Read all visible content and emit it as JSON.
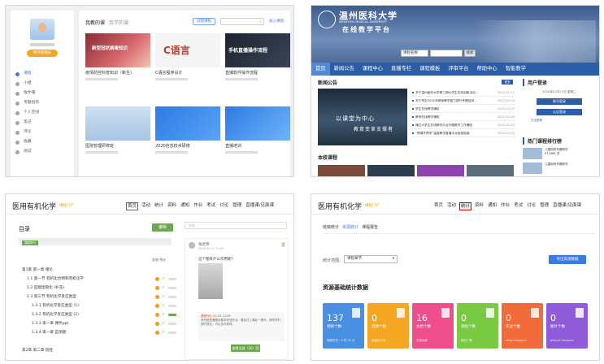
{
  "p1": {
    "badge": "教师管理员",
    "menu": [
      "课程",
      "小组",
      "收件箱",
      "专题创作",
      "个人空间",
      "笔记",
      "评论",
      "收藏",
      "测试"
    ],
    "tabs": [
      "我教的课",
      "我学的课"
    ],
    "create_btn": "创建课程",
    "join_label": "加入课程",
    "courses": [
      {
        "title": "疫情防控科普知识（新生）",
        "img": "新型冠状病毒知识"
      },
      {
        "title": "C语言程序设计",
        "img": "C语言"
      },
      {
        "title": "直播软件操作流程",
        "img": "手机直播操作流程"
      },
      {
        "title": "医院管理研修班",
        "img": ""
      },
      {
        "title": "2020信息技术研修",
        "img": ""
      },
      {
        "title": "直播培训",
        "img": ""
      }
    ]
  },
  "p2": {
    "uni_cn": "温州医科大学",
    "uni_en": "WENZHOU MEDICAL UNIVERSITY",
    "platform": "在线教学平台",
    "search_select": "课程名称",
    "search_btn": "搜索",
    "nav": [
      "首页",
      "新闻公告",
      "课程中心",
      "直播专栏",
      "课程模板",
      "评审平台",
      "帮助中心",
      "智能教学"
    ],
    "news_title": "新闻公告",
    "more": "更多",
    "photo_line1": "以课堂为中心",
    "photo_line2": "教育变革支撑者",
    "news": [
      {
        "t": "关于温州医科大学第三期大学生在线创新活动...",
        "d": "2020-02-11"
      },
      {
        "t": "关于举办2020年教师教学能力提升专题培训...",
        "d": "2020-02-09"
      },
      {
        "t": "学生在线教学通知",
        "d": "2020-02-07"
      },
      {
        "t": "教师在线教学通知",
        "d": "2020-02-06"
      },
      {
        "t": "通过大学生在线教学平台开展教学工作通知",
        "d": "2020-02-05"
      },
      {
        "t": "“停课不停学”温医教学直播平台使用指南",
        "d": "2020-02-03"
      }
    ],
    "login_title": "用户登录",
    "login_date": "2020年02月11日 星期二",
    "login_btn1": "账号登录",
    "login_btn2": "认证登录",
    "forgot": "忘记密码",
    "rank_title": "热门课程排行榜",
    "rank": [
      {
        "name": "儿童用药专题研究",
        "sub": "972484 次"
      },
      {
        "name": "儿童用药专题研究",
        "sub": ""
      }
    ],
    "sect": "本校课程"
  },
  "p3": {
    "title": "医用有机化学",
    "logo": "课程门户",
    "nav": [
      "首页",
      "活动",
      "统计",
      "资料",
      "通知",
      "作业",
      "考试",
      "讨论",
      "管理",
      "直播课/见面课"
    ],
    "catalog": "目录",
    "edit": "编辑",
    "chip": "课程章节",
    "cols": "发放 统计",
    "tree": [
      {
        "t": "第1章 第一章 绪论",
        "lv": 0,
        "icons": false
      },
      {
        "t": "1.1 第一节 有机化合物和有机化学",
        "lv": 1,
        "icons": true,
        "gr": false
      },
      {
        "t": "1.2 官能团简化 (补充)",
        "lv": 1,
        "icons": true,
        "gr": false
      },
      {
        "t": "1.3 第三节 有机化学反应类型",
        "lv": 1,
        "icons": true,
        "gr": false
      },
      {
        "t": "1.3.1 有机化学反应类型 (1)",
        "lv": 2,
        "icons": true,
        "gr": false
      },
      {
        "t": "1.3.2 有机化学反应类型 (2)",
        "lv": 2,
        "icons": true,
        "gr": true
      },
      {
        "t": "1.3.3 第一章 课件ppt",
        "lv": 2,
        "icons": true,
        "gr": false
      },
      {
        "t": "1.3.4 第一章 自测题",
        "lv": 2,
        "icons": true,
        "gr": false
      },
      {
        "t": "",
        "lv": 0,
        "icons": false
      },
      {
        "t": "第2章 第二章 烷烃",
        "lv": 0,
        "icons": false
      }
    ],
    "search_ph": "搜索",
    "post_name": "张老师",
    "post_date": "2019-10-11 15:00",
    "post_tag": "置",
    "post_text": "这个图有什么作用呢？",
    "reply_name": "课程作业",
    "reply_date": "01-03 13:28",
    "reply_text": "请仔细查看题目要求完成作业，题目在上课后一周内，请同学们按时提交，可以多次修改。",
    "view_btn": "查看全部（20）回复"
  },
  "p4": {
    "title": "医用有机化学",
    "logo": "课程门户",
    "nav": [
      "首页",
      "活动",
      "统计",
      "资料",
      "通知",
      "作业",
      "考试",
      "讨论",
      "管理",
      "直播课/见面课"
    ],
    "sub": [
      "班级统计",
      "资源统计",
      "课程报告"
    ],
    "range_label": "统计范围：",
    "range_value": "课程章节",
    "export": "导出资源数据",
    "heading": "资源基础统计数据",
    "cards": [
      {
        "n": "137",
        "u": "视频个数",
        "f": "视频时长：3 时 32 分",
        "c": "#4a90e2"
      },
      {
        "n": "0",
        "u": "音频个数",
        "f": "音频总时长",
        "c": "#f5a623"
      },
      {
        "n": "16",
        "u": "文档个数",
        "f": "文档页数",
        "c": "#ee4f8c"
      },
      {
        "n": "0",
        "u": "测验个数",
        "f": "题目个数",
        "c": "#7ac943"
      },
      {
        "n": "0",
        "u": "作业个数",
        "f": "other resource",
        "c": "#f26b3a"
      },
      {
        "n": "0",
        "u": "图片个数",
        "f": "picture resource",
        "c": "#8e5cd9"
      }
    ]
  }
}
